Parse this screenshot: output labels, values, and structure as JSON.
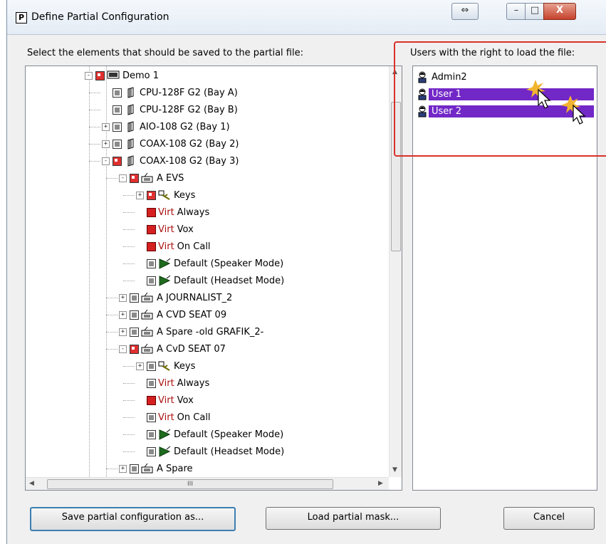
{
  "window": {
    "title": "Define Partial Configuration",
    "icon_letter": "P",
    "controls": {
      "dock": "⇔",
      "minimize": "–",
      "maximize": "□",
      "close": "X"
    }
  },
  "left_header": "Select the elements that should be saved to the partial file:",
  "right_header": "Users with the right to load the file:",
  "tree": [
    {
      "label": "Demo 1",
      "virt": "",
      "icon": "frame-icon",
      "check": "part",
      "expander": "-",
      "level": 0
    },
    {
      "label": "CPU-128F G2 (Bay A)",
      "virt": "",
      "icon": "card-icon",
      "check": "gray",
      "expander": "",
      "level": 1
    },
    {
      "label": "CPU-128F G2 (Bay B)",
      "virt": "",
      "icon": "card-icon",
      "check": "gray",
      "expander": "",
      "level": 1
    },
    {
      "label": "AIO-108 G2 (Bay  1)",
      "virt": "",
      "icon": "card-icon",
      "check": "gray",
      "expander": "+",
      "level": 1
    },
    {
      "label": "COAX-108 G2 (Bay  2)",
      "virt": "",
      "icon": "card-icon",
      "check": "gray",
      "expander": "+",
      "level": 1
    },
    {
      "label": "COAX-108 G2 (Bay  3)",
      "virt": "",
      "icon": "card-icon",
      "check": "part",
      "expander": "-",
      "level": 1
    },
    {
      "label": "A EVS",
      "virt": "",
      "icon": "panel-icon",
      "check": "part",
      "expander": "-",
      "level": 2
    },
    {
      "label": "Keys",
      "virt": "",
      "icon": "keys-icon",
      "check": "part",
      "expander": "+",
      "level": 3
    },
    {
      "label": "Always",
      "virt": "Virt",
      "icon": "",
      "check": "full",
      "expander": "",
      "level": 3
    },
    {
      "label": "Vox",
      "virt": "Virt",
      "icon": "",
      "check": "full",
      "expander": "",
      "level": 3
    },
    {
      "label": "On Call",
      "virt": "Virt",
      "icon": "",
      "check": "full",
      "expander": "",
      "level": 3
    },
    {
      "label": "Default (Speaker Mode)",
      "virt": "",
      "icon": "mode-icon",
      "check": "gray",
      "expander": "",
      "level": 3
    },
    {
      "label": "Default (Headset Mode)",
      "virt": "",
      "icon": "mode-icon",
      "check": "gray",
      "expander": "",
      "level": 3
    },
    {
      "label": "A JOURNALIST_2",
      "virt": "",
      "icon": "panel-icon",
      "check": "gray",
      "expander": "+",
      "level": 2
    },
    {
      "label": "A CVD SEAT 09",
      "virt": "",
      "icon": "panel-icon",
      "check": "gray",
      "expander": "+",
      "level": 2
    },
    {
      "label": "A Spare -old GRAFIK_2-",
      "virt": "",
      "icon": "panel-icon",
      "check": "gray",
      "expander": "+",
      "level": 2
    },
    {
      "label": "A CvD SEAT 07",
      "virt": "",
      "icon": "panel-icon",
      "check": "part",
      "expander": "-",
      "level": 2
    },
    {
      "label": "Keys",
      "virt": "",
      "icon": "keys-icon",
      "check": "gray",
      "expander": "+",
      "level": 3
    },
    {
      "label": "Always",
      "virt": "Virt",
      "icon": "",
      "check": "gray",
      "expander": "",
      "level": 3
    },
    {
      "label": "Vox",
      "virt": "Virt",
      "icon": "",
      "check": "full",
      "expander": "",
      "level": 3
    },
    {
      "label": "On Call",
      "virt": "Virt",
      "icon": "",
      "check": "gray",
      "expander": "",
      "level": 3
    },
    {
      "label": "Default (Speaker Mode)",
      "virt": "",
      "icon": "mode-icon",
      "check": "gray",
      "expander": "",
      "level": 3
    },
    {
      "label": "Default (Headset Mode)",
      "virt": "",
      "icon": "mode-icon",
      "check": "gray",
      "expander": "",
      "level": 3
    },
    {
      "label": "A Spare",
      "virt": "",
      "icon": "panel-icon",
      "check": "gray",
      "expander": "+",
      "level": 2
    }
  ],
  "hscroll_grip": "III",
  "users": [
    {
      "name": "Admin2",
      "selected": false
    },
    {
      "name": "User 1",
      "selected": true
    },
    {
      "name": "User 2",
      "selected": true
    }
  ],
  "buttons": {
    "save": "Save partial configuration as...",
    "load": "Load partial mask...",
    "cancel": "Cancel"
  },
  "colors": {
    "selection": "#7227c7",
    "highlight_border": "#d9312a",
    "checked_red": "#d42020"
  }
}
